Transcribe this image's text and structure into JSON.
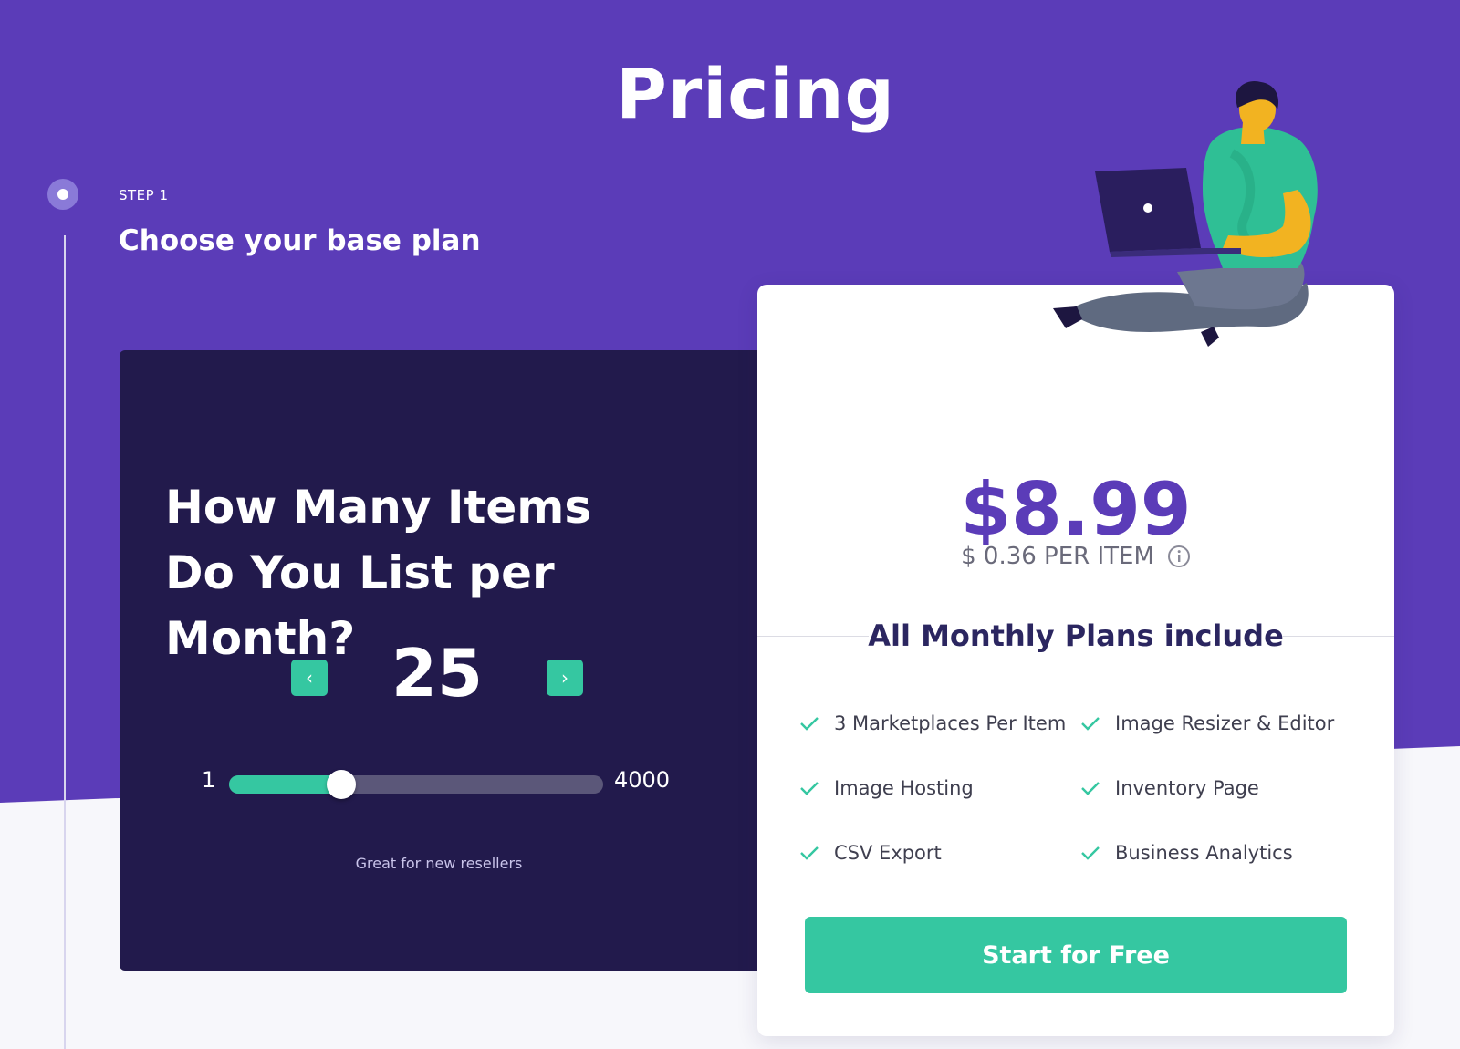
{
  "page": {
    "title": "Pricing"
  },
  "step": {
    "label": "STEP 1",
    "heading": "Choose your base plan"
  },
  "selector": {
    "question_line1": "How Many Items",
    "question_line2": "Do You List per Month?",
    "prev_icon": "chevron-left-icon",
    "next_icon": "chevron-right-icon",
    "prev_glyph": "‹",
    "next_glyph": "›",
    "count": "25",
    "slider_min": "1",
    "slider_max": "4000",
    "slider_fraction": 0.3,
    "hint": "Great for new resellers"
  },
  "plan": {
    "price": "$8.99",
    "per_item": "$ 0.36 PER ITEM",
    "info_icon": "info-icon",
    "includes_heading": "All Monthly Plans include",
    "features": [
      "3 Marketplaces Per Item",
      "Image Resizer & Editor",
      "Image Hosting",
      "Inventory Page",
      "CSV Export",
      "Business Analytics"
    ],
    "feature_icon": "check-icon",
    "cta_label": "Start for Free"
  },
  "colors": {
    "brand_purple": "#5b3cb8",
    "dark_navy": "#221a4c",
    "accent_teal": "#35c7a1"
  }
}
